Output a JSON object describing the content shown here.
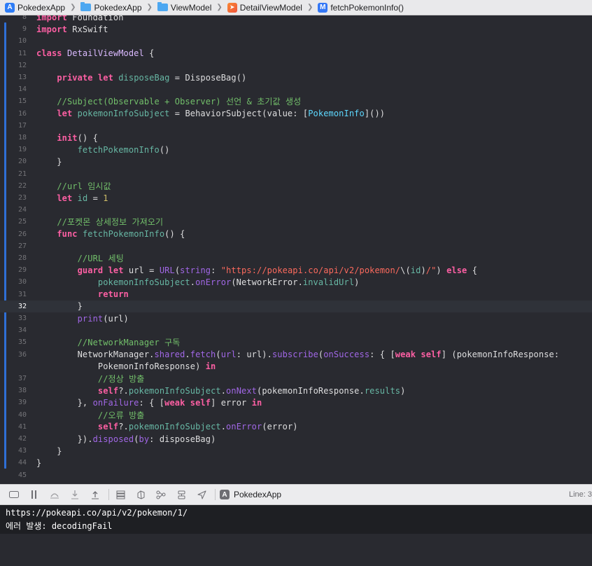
{
  "breadcrumb": {
    "items": [
      {
        "label": "PokedexApp",
        "icon": "app-icon"
      },
      {
        "label": "PokedexApp",
        "icon": "folder-icon"
      },
      {
        "label": "ViewModel",
        "icon": "folder-icon"
      },
      {
        "label": "DetailViewModel",
        "icon": "swift-file-icon"
      },
      {
        "label": "fetchPokemonInfo()",
        "icon": "method-icon"
      }
    ]
  },
  "editor": {
    "current_line": "32",
    "lines": [
      {
        "n": "8",
        "t": [
          [
            "kw",
            "import"
          ],
          [
            "pl",
            " Foundation"
          ]
        ]
      },
      {
        "n": "9",
        "t": [
          [
            "kw",
            "import"
          ],
          [
            "pl",
            " RxSwift"
          ]
        ]
      },
      {
        "n": "10",
        "t": []
      },
      {
        "n": "11",
        "t": [
          [
            "kw",
            "class"
          ],
          [
            "pl",
            " "
          ],
          [
            "cl",
            "DetailViewModel"
          ],
          [
            "pl",
            " {"
          ]
        ]
      },
      {
        "n": "12",
        "t": []
      },
      {
        "n": "13",
        "t": [
          [
            "pl",
            "    "
          ],
          [
            "kw",
            "private"
          ],
          [
            "pl",
            " "
          ],
          [
            "kw",
            "let"
          ],
          [
            "pl",
            " "
          ],
          [
            "pr",
            "disposeBag"
          ],
          [
            "pl",
            " = DisposeBag()"
          ]
        ]
      },
      {
        "n": "14",
        "t": []
      },
      {
        "n": "15",
        "t": [
          [
            "pl",
            "    "
          ],
          [
            "cm",
            "//Subject(Observable + Observer) 선언 & 초기값 생성"
          ]
        ]
      },
      {
        "n": "16",
        "t": [
          [
            "pl",
            "    "
          ],
          [
            "kw",
            "let"
          ],
          [
            "pl",
            " "
          ],
          [
            "pr",
            "pokemonInfoSubject"
          ],
          [
            "pl",
            " = BehaviorSubject(value: ["
          ],
          [
            "ty",
            "PokemonInfo"
          ],
          [
            "pl",
            "]())"
          ]
        ]
      },
      {
        "n": "17",
        "t": []
      },
      {
        "n": "18",
        "t": [
          [
            "pl",
            "    "
          ],
          [
            "kw",
            "init"
          ],
          [
            "pl",
            "() {"
          ]
        ]
      },
      {
        "n": "19",
        "t": [
          [
            "pl",
            "        "
          ],
          [
            "pr",
            "fetchPokemonInfo"
          ],
          [
            "pl",
            "()"
          ]
        ]
      },
      {
        "n": "20",
        "t": [
          [
            "pl",
            "    }"
          ]
        ]
      },
      {
        "n": "21",
        "t": []
      },
      {
        "n": "22",
        "t": [
          [
            "pl",
            "    "
          ],
          [
            "cm",
            "//url 임시값"
          ]
        ]
      },
      {
        "n": "23",
        "t": [
          [
            "pl",
            "    "
          ],
          [
            "kw",
            "let"
          ],
          [
            "pl",
            " "
          ],
          [
            "pr",
            "id"
          ],
          [
            "pl",
            " = "
          ],
          [
            "nu",
            "1"
          ]
        ]
      },
      {
        "n": "24",
        "t": []
      },
      {
        "n": "25",
        "t": [
          [
            "pl",
            "    "
          ],
          [
            "cm",
            "//포켓몬 상세정보 가져오기"
          ]
        ]
      },
      {
        "n": "26",
        "t": [
          [
            "pl",
            "    "
          ],
          [
            "kw",
            "func"
          ],
          [
            "pl",
            " "
          ],
          [
            "pr",
            "fetchPokemonInfo"
          ],
          [
            "pl",
            "() {"
          ]
        ]
      },
      {
        "n": "27",
        "t": []
      },
      {
        "n": "28",
        "t": [
          [
            "pl",
            "        "
          ],
          [
            "cm",
            "//URL 세팅"
          ]
        ]
      },
      {
        "n": "29",
        "t": [
          [
            "pl",
            "        "
          ],
          [
            "kw",
            "guard"
          ],
          [
            "pl",
            " "
          ],
          [
            "kw",
            "let"
          ],
          [
            "pl",
            " url = "
          ],
          [
            "fn",
            "URL"
          ],
          [
            "pl",
            "("
          ],
          [
            "fn",
            "string"
          ],
          [
            "pl",
            ": "
          ],
          [
            "st",
            "\"https://pokeapi.co/api/v2/pokemon/"
          ],
          [
            "pl",
            "\\("
          ],
          [
            "pr",
            "id"
          ],
          [
            "pl",
            ")"
          ],
          [
            "st",
            "/\""
          ],
          [
            "pl",
            ") "
          ],
          [
            "kw",
            "else"
          ],
          [
            "pl",
            " {"
          ]
        ]
      },
      {
        "n": "30",
        "t": [
          [
            "pl",
            "            "
          ],
          [
            "pr",
            "pokemonInfoSubject"
          ],
          [
            "pl",
            "."
          ],
          [
            "fn",
            "onError"
          ],
          [
            "pl",
            "(NetworkError."
          ],
          [
            "pr",
            "invalidUrl"
          ],
          [
            "pl",
            ")"
          ]
        ]
      },
      {
        "n": "31",
        "t": [
          [
            "pl",
            "            "
          ],
          [
            "kw",
            "return"
          ]
        ]
      },
      {
        "n": "32",
        "t": [
          [
            "pl",
            "        }"
          ]
        ]
      },
      {
        "n": "33",
        "t": [
          [
            "pl",
            "        "
          ],
          [
            "fn",
            "print"
          ],
          [
            "pl",
            "(url)"
          ]
        ]
      },
      {
        "n": "34",
        "t": []
      },
      {
        "n": "35",
        "t": [
          [
            "pl",
            "        "
          ],
          [
            "cm",
            "//NetworkManager 구독"
          ]
        ]
      },
      {
        "n": "36",
        "t": [
          [
            "pl",
            "        NetworkManager."
          ],
          [
            "fn",
            "shared"
          ],
          [
            "pl",
            "."
          ],
          [
            "fn",
            "fetch"
          ],
          [
            "pl",
            "("
          ],
          [
            "fn",
            "url"
          ],
          [
            "pl",
            ": url)."
          ],
          [
            "fn",
            "subscribe"
          ],
          [
            "pl",
            "("
          ],
          [
            "fn",
            "onSuccess"
          ],
          [
            "pl",
            ": { ["
          ],
          [
            "kw",
            "weak"
          ],
          [
            "pl",
            " "
          ],
          [
            "kw",
            "self"
          ],
          [
            "pl",
            "] (pokemonInfoResponse:"
          ]
        ]
      },
      {
        "n": "",
        "t": [
          [
            "pl",
            "            PokemonInfoResponse) "
          ],
          [
            "kw",
            "in"
          ]
        ]
      },
      {
        "n": "37",
        "t": [
          [
            "pl",
            "            "
          ],
          [
            "cm",
            "//정상 방출"
          ]
        ]
      },
      {
        "n": "38",
        "t": [
          [
            "pl",
            "            "
          ],
          [
            "kw",
            "self"
          ],
          [
            "pl",
            "?."
          ],
          [
            "pr",
            "pokemonInfoSubject"
          ],
          [
            "pl",
            "."
          ],
          [
            "fn",
            "onNext"
          ],
          [
            "pl",
            "(pokemonInfoResponse."
          ],
          [
            "pr",
            "results"
          ],
          [
            "pl",
            ")"
          ]
        ]
      },
      {
        "n": "39",
        "t": [
          [
            "pl",
            "        }, "
          ],
          [
            "fn",
            "onFailure"
          ],
          [
            "pl",
            ": { ["
          ],
          [
            "kw",
            "weak"
          ],
          [
            "pl",
            " "
          ],
          [
            "kw",
            "self"
          ],
          [
            "pl",
            "] error "
          ],
          [
            "kw",
            "in"
          ]
        ]
      },
      {
        "n": "40",
        "t": [
          [
            "pl",
            "            "
          ],
          [
            "cm",
            "//오류 방출"
          ]
        ]
      },
      {
        "n": "41",
        "t": [
          [
            "pl",
            "            "
          ],
          [
            "kw",
            "self"
          ],
          [
            "pl",
            "?."
          ],
          [
            "pr",
            "pokemonInfoSubject"
          ],
          [
            "pl",
            "."
          ],
          [
            "fn",
            "onError"
          ],
          [
            "pl",
            "(error)"
          ]
        ]
      },
      {
        "n": "42",
        "t": [
          [
            "pl",
            "        })."
          ],
          [
            "fn",
            "disposed"
          ],
          [
            "pl",
            "("
          ],
          [
            "fn",
            "by"
          ],
          [
            "pl",
            ": disposeBag)"
          ]
        ]
      },
      {
        "n": "43",
        "t": [
          [
            "pl",
            "    }"
          ]
        ]
      },
      {
        "n": "44",
        "t": [
          [
            "pl",
            "}"
          ]
        ]
      },
      {
        "n": "45",
        "t": []
      }
    ]
  },
  "debugbar": {
    "target_label": "PokedexApp",
    "line_col": "Line: 3"
  },
  "console": {
    "lines": [
      "https://pokeapi.co/api/v2/pokemon/1/",
      "에러 발생: decodingFail"
    ]
  },
  "colors": {
    "background": "#292a30",
    "keyword": "#fc5fa3",
    "type": "#5dd8ff",
    "property": "#67b7a4",
    "function": "#a167e6",
    "comment": "#72bf6a",
    "string": "#fc6a5d",
    "number": "#d0bf69"
  }
}
